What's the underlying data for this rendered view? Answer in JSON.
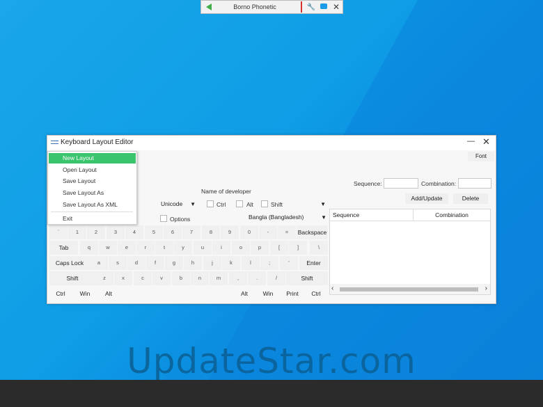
{
  "ime_bar": {
    "language": "Borno Phonetic"
  },
  "window": {
    "title": "Keyboard Layout Editor",
    "font_button": "Font"
  },
  "menu": {
    "items": [
      "New Layout",
      "Open Layout",
      "Save Layout",
      "Save Layout As",
      "Save Layout As XML",
      "Exit"
    ],
    "active_index": 0
  },
  "form": {
    "developer_label": "Name of developer",
    "encoding_select": "Unicode",
    "ctrl_label": "Ctrl",
    "alt_label": "Alt",
    "shift_label": "Shift",
    "options_label": "Options",
    "locale_select": "Bangla (Bangladesh)",
    "sequence_label": "Sequence:",
    "combination_label": "Combination:",
    "add_update_button": "Add/Update",
    "delete_button": "Delete"
  },
  "keyboard": {
    "row1": [
      "`",
      "1",
      "2",
      "3",
      "4",
      "5",
      "6",
      "7",
      "8",
      "9",
      "0",
      "-",
      "=",
      "Backspace"
    ],
    "row2": [
      "Tab",
      "q",
      "w",
      "e",
      "r",
      "t",
      "y",
      "u",
      "i",
      "o",
      "p",
      "[",
      "]",
      "\\"
    ],
    "row3": [
      "Caps Lock",
      "a",
      "s",
      "d",
      "f",
      "g",
      "h",
      "j",
      "k",
      "l",
      ";",
      "'",
      "Enter"
    ],
    "row4": [
      "Shift",
      "z",
      "x",
      "c",
      "v",
      "b",
      "n",
      "m",
      ",",
      ".",
      "/",
      "Shift"
    ],
    "row5_left": [
      "Ctrl",
      "Win",
      "Alt"
    ],
    "row5_right": [
      "Alt",
      "Win",
      "Print",
      "Ctrl"
    ]
  },
  "table": {
    "columns": [
      "Sequence",
      "Combination"
    ]
  },
  "watermark": "UpdateStar.com",
  "colors": {
    "accent_green": "#3ac46d",
    "desktop_blue": "#0e9de6",
    "taskbar": "#2b2b2b"
  }
}
